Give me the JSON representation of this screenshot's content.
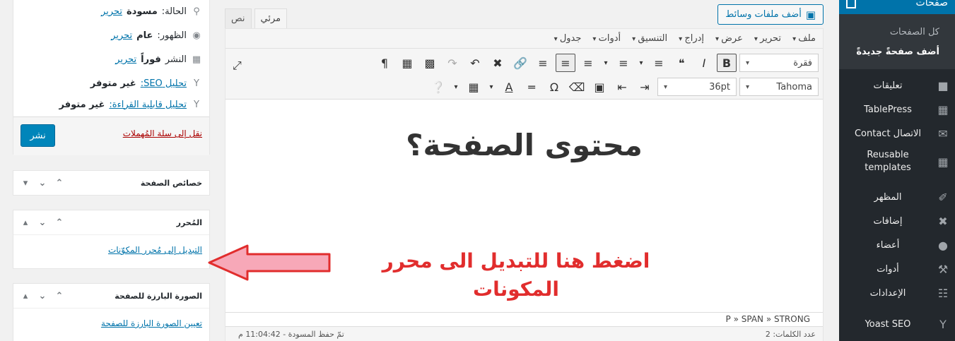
{
  "admin_menu": {
    "current_top": "صفحات",
    "submenu": [
      "كل الصفحات",
      "أضف صفحةً جديدةً"
    ],
    "items": [
      {
        "label": "تعليقات",
        "icon": "comments-icon"
      },
      {
        "label": "TablePress",
        "icon": "tablepress-icon"
      },
      {
        "label": "الاتصال Contact",
        "icon": "mail-icon"
      },
      {
        "label": "Reusable templates",
        "icon": "blocks-icon"
      },
      {
        "label": "المظهر",
        "icon": "appearance-icon"
      },
      {
        "label": "إضافات",
        "icon": "plugins-icon"
      },
      {
        "label": "أعضاء",
        "icon": "users-icon"
      },
      {
        "label": "أدوات",
        "icon": "tools-icon"
      },
      {
        "label": "الإعدادات",
        "icon": "settings-icon"
      },
      {
        "label": "Yoast SEO",
        "icon": "yoast-icon"
      }
    ]
  },
  "editor": {
    "media_button": "أضف ملفات وسائط",
    "tab_visual": "مرئي",
    "tab_text": "نص",
    "menubar": [
      "ملف",
      "تحرير",
      "عرض",
      "إدراج",
      "التنسيق",
      "أدوات",
      "جدول"
    ],
    "format_select": "فقرة",
    "font_family": "Tahoma",
    "font_size": "36pt",
    "content_heading": "محتوى الصفحة؟",
    "path": "P » SPAN » STRONG",
    "word_count": "عدد الكلمات: 2",
    "last_saved": "تمّ حفظ المسودة - 11:04:42 م"
  },
  "publish": {
    "status_label": "الحالة:",
    "status_value": "مسودة",
    "status_edit": "تحرير",
    "visibility_label": "الظهور:",
    "visibility_value": "عام",
    "visibility_edit": "تحرير",
    "publish_label": "النشر",
    "publish_value": "فوراً",
    "publish_edit": "تحرير",
    "seo_link": "تحليل SEO:",
    "seo_value": "غير متوفر",
    "readability_link": "تحليل قابلية القراءة:",
    "readability_value": "غير متوفر",
    "trash_link": "نقل إلى سلة المُهملات",
    "publish_button": "نشر"
  },
  "panels": {
    "page_attributes": "خصائص الصفحة",
    "editor_title": "المُحرر",
    "switch_link": "التبديل إلى مُحرر المكوّنات",
    "featured_title": "الصورة البارزة للصفحة",
    "featured_link": "تعيين الصورة البارزة للصفحة"
  },
  "annotation": {
    "text": "اضغط هنا للتبديل الى محرر المكونات",
    "color": "#e12d2d",
    "arrow_fill": "#f7a8b8"
  }
}
